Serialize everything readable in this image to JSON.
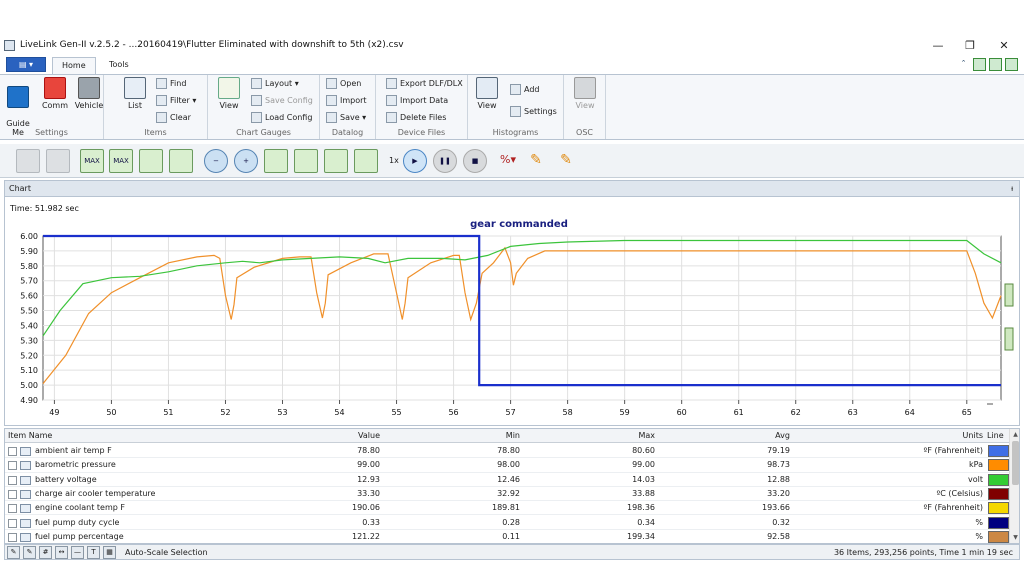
{
  "window": {
    "title": "LiveLink Gen-II  v.2.5.2 - ...20160419\\Flutter Eliminated with downshift to 5th (x2).csv",
    "minimize": "—",
    "maximize": "❐",
    "close": "✕"
  },
  "ribbon_tabs": {
    "file": "▤ ▾",
    "items": [
      "Home",
      "Tools"
    ]
  },
  "ribbon": {
    "settings": {
      "label": "Settings",
      "guide": "Guide\nMe",
      "comm": "Comm",
      "vehicle": "Vehicle"
    },
    "items": {
      "label": "Items",
      "list": "List",
      "find": "Find",
      "filter": "Filter ▾",
      "clear": "Clear"
    },
    "chart_gauges": {
      "label": "Chart  Gauges",
      "view": "View",
      "layout": "Layout  ▾",
      "save_config": "Save Config",
      "load_config": "Load Config"
    },
    "datalog": {
      "label": "Datalog",
      "open": "Open",
      "import": "Import",
      "save": "Save ▾"
    },
    "device_files": {
      "label": "Device Files",
      "export": "Export DLF/DLX",
      "import_data": "Import Data",
      "delete_files": "Delete Files"
    },
    "histograms": {
      "label": "Histograms",
      "view": "View",
      "add": "Add",
      "settings": "Settings"
    },
    "osc": {
      "label": "OSC",
      "view": "View"
    }
  },
  "toolbar": {
    "max1": "MAX",
    "max2": "MAX",
    "speed": "1x"
  },
  "chart_panel": {
    "header": "Chart",
    "pin": "ᵼ",
    "time_label": "Time: 51.982 sec"
  },
  "chart_data": {
    "type": "line",
    "title": "gear commanded",
    "xlim": [
      48.8,
      65.6
    ],
    "ylim": [
      4.9,
      6.0
    ],
    "x_ticks": [
      49,
      50,
      51,
      52,
      53,
      54,
      55,
      56,
      57,
      58,
      59,
      60,
      61,
      62,
      63,
      64,
      65
    ],
    "y_ticks": [
      "6.00",
      "5.90",
      "5.80",
      "5.70",
      "5.60",
      "5.50",
      "5.40",
      "5.30",
      "5.20",
      "5.10",
      "5.00",
      "4.90"
    ],
    "grid": true,
    "series": [
      {
        "color": "#1a2fcc",
        "points": [
          [
            48.8,
            6.0
          ],
          [
            56.45,
            6.0
          ],
          [
            56.45,
            5.0
          ],
          [
            65.6,
            5.0
          ]
        ]
      },
      {
        "color": "#3cc43c",
        "points": [
          [
            48.8,
            5.33
          ],
          [
            49.1,
            5.5
          ],
          [
            49.5,
            5.68
          ],
          [
            50,
            5.72
          ],
          [
            50.5,
            5.73
          ],
          [
            51,
            5.76
          ],
          [
            51.5,
            5.8
          ],
          [
            52,
            5.82
          ],
          [
            52.3,
            5.83
          ],
          [
            52.6,
            5.82
          ],
          [
            53,
            5.84
          ],
          [
            53.5,
            5.85
          ],
          [
            54,
            5.86
          ],
          [
            54.5,
            5.85
          ],
          [
            54.8,
            5.82
          ],
          [
            55.2,
            5.85
          ],
          [
            55.8,
            5.85
          ],
          [
            56.2,
            5.84
          ],
          [
            56.6,
            5.87
          ],
          [
            57,
            5.93
          ],
          [
            57.5,
            5.95
          ],
          [
            58,
            5.96
          ],
          [
            59,
            5.97
          ],
          [
            60,
            5.97
          ],
          [
            61,
            5.97
          ],
          [
            62,
            5.97
          ],
          [
            63,
            5.97
          ],
          [
            64,
            5.97
          ],
          [
            65,
            5.97
          ],
          [
            65.3,
            5.88
          ],
          [
            65.6,
            5.82
          ]
        ]
      },
      {
        "color": "#f0902a",
        "points": [
          [
            48.8,
            5.01
          ],
          [
            49.2,
            5.2
          ],
          [
            49.6,
            5.48
          ],
          [
            50,
            5.62
          ],
          [
            50.5,
            5.72
          ],
          [
            51,
            5.82
          ],
          [
            51.5,
            5.86
          ],
          [
            51.8,
            5.87
          ],
          [
            51.9,
            5.85
          ],
          [
            52,
            5.6
          ],
          [
            52.1,
            5.44
          ],
          [
            52.15,
            5.54
          ],
          [
            52.2,
            5.72
          ],
          [
            52.5,
            5.79
          ],
          [
            53,
            5.85
          ],
          [
            53.3,
            5.86
          ],
          [
            53.5,
            5.86
          ],
          [
            53.6,
            5.62
          ],
          [
            53.7,
            5.45
          ],
          [
            53.75,
            5.55
          ],
          [
            53.8,
            5.74
          ],
          [
            54.2,
            5.82
          ],
          [
            54.6,
            5.88
          ],
          [
            54.85,
            5.88
          ],
          [
            55.0,
            5.62
          ],
          [
            55.1,
            5.44
          ],
          [
            55.15,
            5.55
          ],
          [
            55.2,
            5.72
          ],
          [
            55.6,
            5.82
          ],
          [
            56.0,
            5.87
          ],
          [
            56.1,
            5.87
          ],
          [
            56.2,
            5.62
          ],
          [
            56.3,
            5.44
          ],
          [
            56.4,
            5.55
          ],
          [
            56.5,
            5.75
          ],
          [
            56.7,
            5.82
          ],
          [
            56.9,
            5.92
          ],
          [
            57.0,
            5.82
          ],
          [
            57.05,
            5.67
          ],
          [
            57.1,
            5.75
          ],
          [
            57.3,
            5.85
          ],
          [
            57.6,
            5.9
          ],
          [
            58,
            5.9
          ],
          [
            59,
            5.9
          ],
          [
            60,
            5.9
          ],
          [
            61,
            5.9
          ],
          [
            62,
            5.9
          ],
          [
            63,
            5.9
          ],
          [
            64,
            5.9
          ],
          [
            65,
            5.9
          ],
          [
            65.15,
            5.75
          ],
          [
            65.3,
            5.55
          ],
          [
            65.45,
            5.45
          ],
          [
            65.6,
            5.6
          ]
        ]
      }
    ]
  },
  "grid": {
    "headers": {
      "name": "Item Name",
      "value": "Value",
      "min": "Min",
      "max": "Max",
      "avg": "Avg",
      "units": "Units",
      "line": "Line"
    },
    "rows": [
      {
        "name": "ambient air temp F",
        "value": "78.80",
        "min": "78.80",
        "max": "80.60",
        "avg": "79.19",
        "units": "ºF (Fahrenheit)",
        "color": "#3f6ee6"
      },
      {
        "name": "barometric pressure",
        "value": "99.00",
        "min": "98.00",
        "max": "99.00",
        "avg": "98.73",
        "units": "kPa",
        "color": "#ff8c00"
      },
      {
        "name": "battery voltage",
        "value": "12.93",
        "min": "12.46",
        "max": "14.03",
        "avg": "12.88",
        "units": "volt",
        "color": "#33cc33"
      },
      {
        "name": "charge air cooler temperature",
        "value": "33.30",
        "min": "32.92",
        "max": "33.88",
        "avg": "33.20",
        "units": "ºC (Celsius)",
        "color": "#800000"
      },
      {
        "name": "engine coolant temp F",
        "value": "190.06",
        "min": "189.81",
        "max": "198.36",
        "avg": "193.66",
        "units": "ºF (Fahrenheit)",
        "color": "#f5d800"
      },
      {
        "name": "fuel pump duty cycle",
        "value": "0.33",
        "min": "0.28",
        "max": "0.34",
        "avg": "0.32",
        "units": "%",
        "color": "#000080"
      },
      {
        "name": "fuel pump percentage",
        "value": "121.22",
        "min": "0.11",
        "max": "199.34",
        "avg": "92.58",
        "units": "%",
        "color": "#cc8844"
      }
    ]
  },
  "statusbar": {
    "auto_scale": "Auto-Scale Selection",
    "info": "36 Items, 293,256 points, Time 1 min 19 sec"
  }
}
